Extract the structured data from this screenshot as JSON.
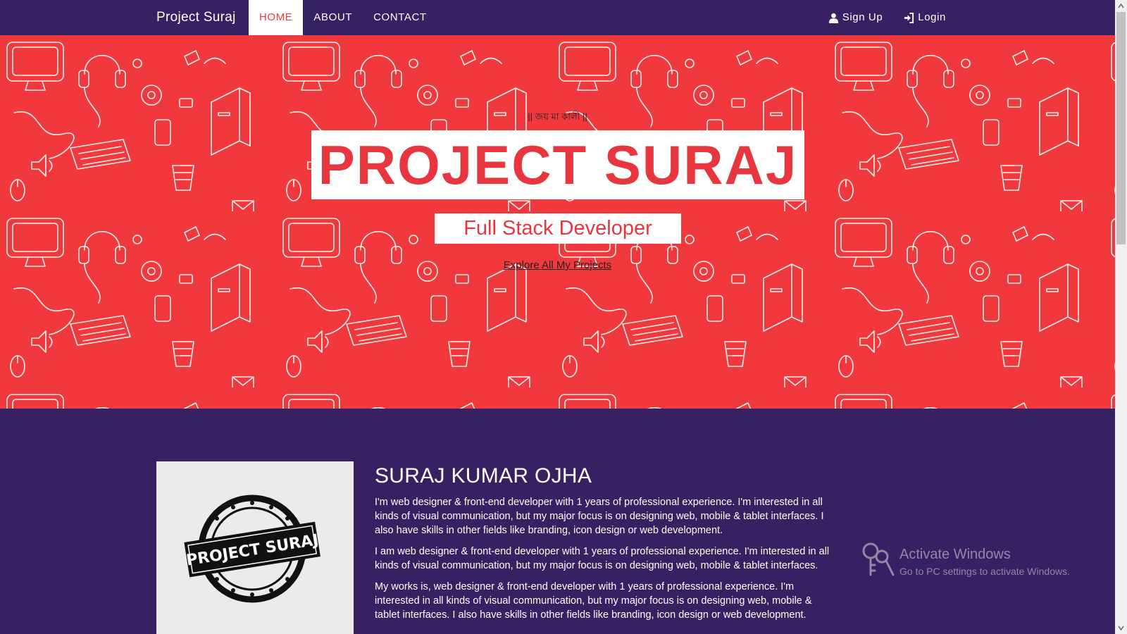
{
  "nav": {
    "brand": "Project Suraj",
    "links": [
      "HOME",
      "ABOUT",
      "CONTACT"
    ],
    "signup": "Sign Up",
    "login": "Login"
  },
  "hero": {
    "motto": "|| জয় মা কালী ||",
    "title": "PROJECT SURAJ",
    "subtitle": "Full Stack Developer",
    "link": "Explore All My Projects"
  },
  "about": {
    "name": "SURAJ KUMAR OJHA",
    "photo_text": "PROJECT SURAJ",
    "paragraphs": [
      "I'm web designer & front-end developer with 1 years of professional experience. I'm interested in all kinds of visual communication, but my major focus is on designing web, mobile & tablet interfaces. I also have skills in other fields like branding, icon design or web development.",
      "I am web designer & front-end developer with 1 years of professional experience. I'm interested in all kinds of visual communication, but my major focus is on designing web, mobile & tablet interfaces.",
      "My works is, web designer & front-end developer with 1 years of professional experience. I'm interested in all kinds of visual communication, but my major focus is on designing web, mobile & tablet interfaces. I also have skills in other fields like branding, icon design or web development."
    ]
  },
  "watermark": {
    "title": "Activate Windows",
    "subtitle": "Go to PC settings to activate Windows."
  },
  "colors": {
    "nav_bg": "#372163",
    "hero_bg": "#f1383c",
    "accent": "#e8363e",
    "page_bg": "#372163"
  },
  "icons": [
    "user-icon",
    "login-icon",
    "key-icon"
  ]
}
